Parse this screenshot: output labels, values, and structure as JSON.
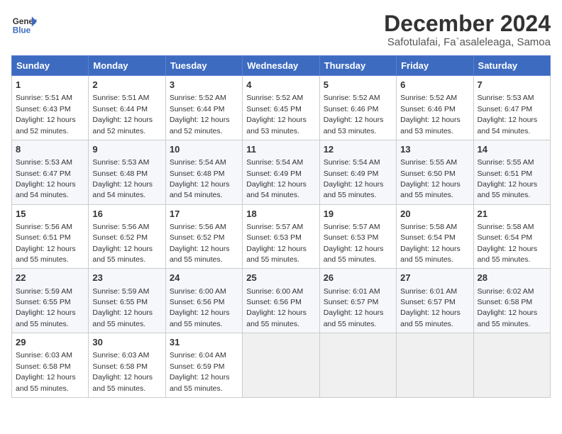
{
  "logo": {
    "line1": "General",
    "line2": "Blue"
  },
  "title": "December 2024",
  "subtitle": "Safotulafai, Fa`asaleleaga, Samoa",
  "headers": [
    "Sunday",
    "Monday",
    "Tuesday",
    "Wednesday",
    "Thursday",
    "Friday",
    "Saturday"
  ],
  "weeks": [
    [
      {
        "day": "1",
        "sunrise": "5:51 AM",
        "sunset": "6:43 PM",
        "daylight": "12 hours and 52 minutes."
      },
      {
        "day": "2",
        "sunrise": "5:51 AM",
        "sunset": "6:44 PM",
        "daylight": "12 hours and 52 minutes."
      },
      {
        "day": "3",
        "sunrise": "5:52 AM",
        "sunset": "6:44 PM",
        "daylight": "12 hours and 52 minutes."
      },
      {
        "day": "4",
        "sunrise": "5:52 AM",
        "sunset": "6:45 PM",
        "daylight": "12 hours and 53 minutes."
      },
      {
        "day": "5",
        "sunrise": "5:52 AM",
        "sunset": "6:46 PM",
        "daylight": "12 hours and 53 minutes."
      },
      {
        "day": "6",
        "sunrise": "5:52 AM",
        "sunset": "6:46 PM",
        "daylight": "12 hours and 53 minutes."
      },
      {
        "day": "7",
        "sunrise": "5:53 AM",
        "sunset": "6:47 PM",
        "daylight": "12 hours and 54 minutes."
      }
    ],
    [
      {
        "day": "8",
        "sunrise": "5:53 AM",
        "sunset": "6:47 PM",
        "daylight": "12 hours and 54 minutes."
      },
      {
        "day": "9",
        "sunrise": "5:53 AM",
        "sunset": "6:48 PM",
        "daylight": "12 hours and 54 minutes."
      },
      {
        "day": "10",
        "sunrise": "5:54 AM",
        "sunset": "6:48 PM",
        "daylight": "12 hours and 54 minutes."
      },
      {
        "day": "11",
        "sunrise": "5:54 AM",
        "sunset": "6:49 PM",
        "daylight": "12 hours and 54 minutes."
      },
      {
        "day": "12",
        "sunrise": "5:54 AM",
        "sunset": "6:49 PM",
        "daylight": "12 hours and 55 minutes."
      },
      {
        "day": "13",
        "sunrise": "5:55 AM",
        "sunset": "6:50 PM",
        "daylight": "12 hours and 55 minutes."
      },
      {
        "day": "14",
        "sunrise": "5:55 AM",
        "sunset": "6:51 PM",
        "daylight": "12 hours and 55 minutes."
      }
    ],
    [
      {
        "day": "15",
        "sunrise": "5:56 AM",
        "sunset": "6:51 PM",
        "daylight": "12 hours and 55 minutes."
      },
      {
        "day": "16",
        "sunrise": "5:56 AM",
        "sunset": "6:52 PM",
        "daylight": "12 hours and 55 minutes."
      },
      {
        "day": "17",
        "sunrise": "5:56 AM",
        "sunset": "6:52 PM",
        "daylight": "12 hours and 55 minutes."
      },
      {
        "day": "18",
        "sunrise": "5:57 AM",
        "sunset": "6:53 PM",
        "daylight": "12 hours and 55 minutes."
      },
      {
        "day": "19",
        "sunrise": "5:57 AM",
        "sunset": "6:53 PM",
        "daylight": "12 hours and 55 minutes."
      },
      {
        "day": "20",
        "sunrise": "5:58 AM",
        "sunset": "6:54 PM",
        "daylight": "12 hours and 55 minutes."
      },
      {
        "day": "21",
        "sunrise": "5:58 AM",
        "sunset": "6:54 PM",
        "daylight": "12 hours and 55 minutes."
      }
    ],
    [
      {
        "day": "22",
        "sunrise": "5:59 AM",
        "sunset": "6:55 PM",
        "daylight": "12 hours and 55 minutes."
      },
      {
        "day": "23",
        "sunrise": "5:59 AM",
        "sunset": "6:55 PM",
        "daylight": "12 hours and 55 minutes."
      },
      {
        "day": "24",
        "sunrise": "6:00 AM",
        "sunset": "6:56 PM",
        "daylight": "12 hours and 55 minutes."
      },
      {
        "day": "25",
        "sunrise": "6:00 AM",
        "sunset": "6:56 PM",
        "daylight": "12 hours and 55 minutes."
      },
      {
        "day": "26",
        "sunrise": "6:01 AM",
        "sunset": "6:57 PM",
        "daylight": "12 hours and 55 minutes."
      },
      {
        "day": "27",
        "sunrise": "6:01 AM",
        "sunset": "6:57 PM",
        "daylight": "12 hours and 55 minutes."
      },
      {
        "day": "28",
        "sunrise": "6:02 AM",
        "sunset": "6:58 PM",
        "daylight": "12 hours and 55 minutes."
      }
    ],
    [
      {
        "day": "29",
        "sunrise": "6:03 AM",
        "sunset": "6:58 PM",
        "daylight": "12 hours and 55 minutes."
      },
      {
        "day": "30",
        "sunrise": "6:03 AM",
        "sunset": "6:58 PM",
        "daylight": "12 hours and 55 minutes."
      },
      {
        "day": "31",
        "sunrise": "6:04 AM",
        "sunset": "6:59 PM",
        "daylight": "12 hours and 55 minutes."
      },
      null,
      null,
      null,
      null
    ]
  ]
}
